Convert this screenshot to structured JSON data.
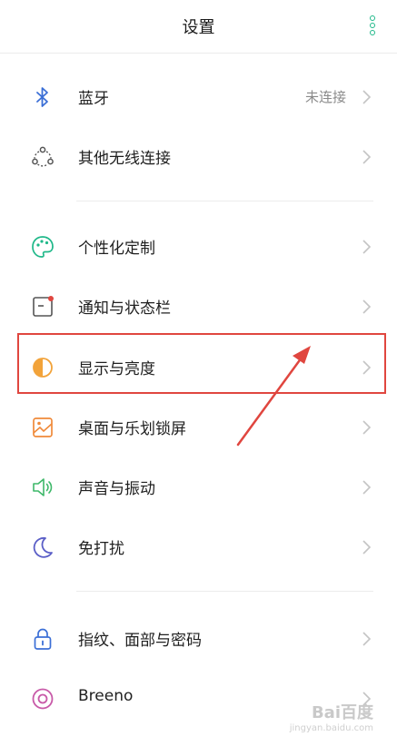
{
  "header": {
    "title": "设置"
  },
  "groups": [
    [
      {
        "label": "蓝牙",
        "value": "未连接",
        "icon": "bluetooth-icon"
      },
      {
        "label": "其他无线连接",
        "icon": "wireless-icon"
      }
    ],
    [
      {
        "label": "个性化定制",
        "icon": "palette-icon"
      },
      {
        "label": "通知与状态栏",
        "icon": "notification-icon"
      },
      {
        "label": "显示与亮度",
        "icon": "brightness-icon"
      },
      {
        "label": "桌面与乐划锁屏",
        "icon": "wallpaper-icon"
      },
      {
        "label": "声音与振动",
        "icon": "speaker-icon"
      },
      {
        "label": "免打扰",
        "icon": "moon-icon"
      }
    ],
    [
      {
        "label": "指纹、面部与密码",
        "icon": "lock-icon"
      },
      {
        "label": "Breeno",
        "icon": "breeno-icon"
      }
    ]
  ],
  "watermark": {
    "text": "Bai百度",
    "sub": "jingyan.baidu.com"
  },
  "colors": {
    "accent": "#1fb889",
    "highlight": "#e0463f"
  }
}
